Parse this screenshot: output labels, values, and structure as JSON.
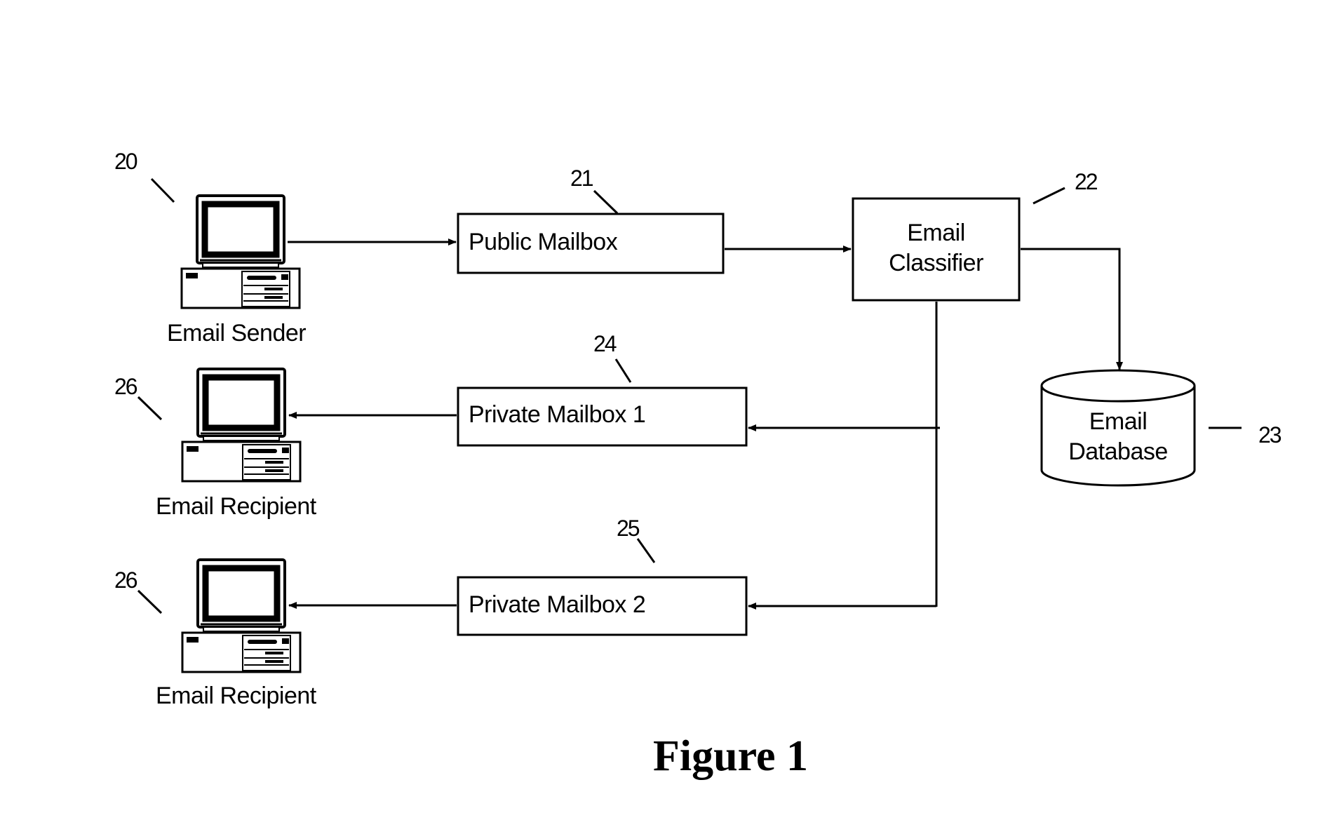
{
  "diagram": {
    "caption": "Figure 1",
    "nodes": {
      "email_sender": {
        "label": "Email Sender",
        "ref": "20",
        "icon": "desktop-computer-icon"
      },
      "public_mailbox": {
        "label": "Public Mailbox",
        "ref": "21"
      },
      "email_classifier": {
        "label_line1": "Email",
        "label_line2": "Classifier",
        "ref": "22"
      },
      "email_database": {
        "label_line1": "Email",
        "label_line2": "Database",
        "ref": "23"
      },
      "private_mailbox_1": {
        "label": "Private Mailbox 1",
        "ref": "24"
      },
      "private_mailbox_2": {
        "label": "Private Mailbox 2",
        "ref": "25"
      },
      "email_recipient_1": {
        "label": "Email Recipient",
        "ref": "26",
        "icon": "desktop-computer-icon"
      },
      "email_recipient_2": {
        "label": "Email Recipient",
        "ref": "26",
        "icon": "desktop-computer-icon"
      }
    },
    "edges": [
      {
        "from": "email_sender",
        "to": "public_mailbox"
      },
      {
        "from": "public_mailbox",
        "to": "email_classifier"
      },
      {
        "from": "email_classifier",
        "to": "email_database"
      },
      {
        "from": "email_classifier",
        "to": "private_mailbox_1"
      },
      {
        "from": "email_classifier",
        "to": "private_mailbox_2"
      },
      {
        "from": "private_mailbox_1",
        "to": "email_recipient_1"
      },
      {
        "from": "private_mailbox_2",
        "to": "email_recipient_2"
      }
    ]
  }
}
